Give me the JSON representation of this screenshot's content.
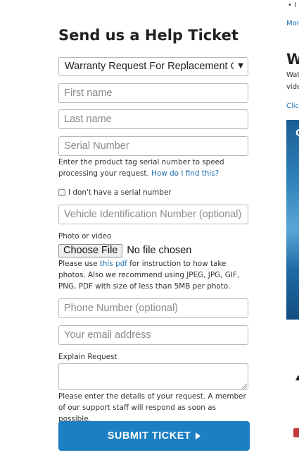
{
  "form": {
    "title": "Send us a Help Ticket",
    "request_type": "Warranty Request For Replacement Component",
    "first_name_placeholder": "First name",
    "last_name_placeholder": "Last name",
    "serial_placeholder": "Serial Number",
    "serial_help_text": "Enter the product tag serial number to speed processing your request.",
    "serial_help_link": "How do I find this?",
    "no_serial_label": "I don't have a serial number",
    "vin_placeholder": "Vehicle Identification Number (optional)",
    "photo_label": "Photo or video",
    "choose_file_label": "Choose File",
    "file_status": "No file chosen",
    "photo_help_before": "Please use ",
    "photo_help_link": "this pdf",
    "photo_help_after": " for instruction to how take photos. Also we recommend using JPEG, JPG, GIF, PNG, PDF with size of less than 5MB per photo.",
    "phone_placeholder": "Phone Number (optional)",
    "email_placeholder": "Your email address",
    "explain_label": "Explain Request",
    "explain_help": "Please enter the details of your request. A member of our support staff will respond as soon as possible.",
    "submit_label": "SUBMIT TICKET"
  },
  "right_column": {
    "bullet_text": "I",
    "more_link": "Mor",
    "heading": "W",
    "text_line1": "Wat",
    "text_line2": "vide",
    "click_link": "Clic",
    "video_letter": "C"
  }
}
